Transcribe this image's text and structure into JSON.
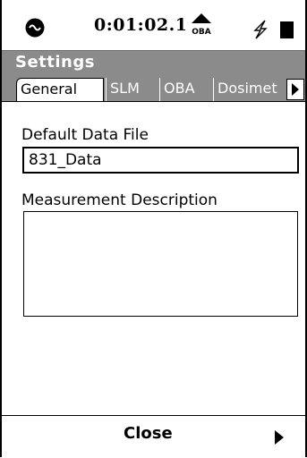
{
  "status": {
    "time": "0:01:02.1",
    "oba_icon_label": "OBA",
    "icons": [
      "microphone-icon",
      "oba-icon",
      "power-bolt-icon",
      "battery-icon"
    ]
  },
  "title": "Settings",
  "tabs": [
    {
      "label": "General",
      "active": true
    },
    {
      "label": "SLM",
      "active": false
    },
    {
      "label": "OBA",
      "active": false
    },
    {
      "label": "Dosimet",
      "active": false
    }
  ],
  "fields": {
    "default_data_file": {
      "label": "Default Data File",
      "value": "831_Data"
    },
    "measurement_description": {
      "label": "Measurement Description",
      "value": ""
    }
  },
  "bottom": {
    "close_label": "Close",
    "next_icon": "right-arrow-icon"
  },
  "colors": {
    "title_bar": "#8b8b8b",
    "text": "#000000",
    "background": "#ffffff"
  }
}
